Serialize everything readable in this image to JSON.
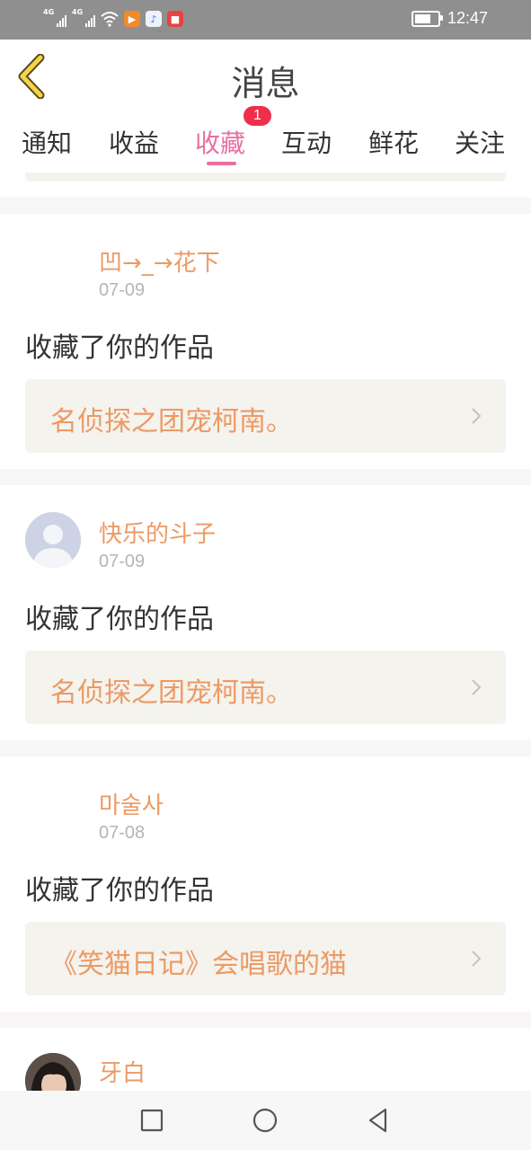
{
  "status_bar": {
    "network_1": "4G",
    "network_2": "4G",
    "time": "12:47",
    "battery_level": 0.85,
    "app_icons": [
      "video-app-icon",
      "music-app-icon",
      "shop-app-icon"
    ]
  },
  "header": {
    "title": "消息",
    "back_icon": "chevron-left-icon"
  },
  "tabs": [
    {
      "label": "通知"
    },
    {
      "label": "收益"
    },
    {
      "label": "收藏",
      "active": true,
      "badge": "1"
    },
    {
      "label": "互动"
    },
    {
      "label": "鲜花"
    },
    {
      "label": "关注"
    }
  ],
  "items": [
    {
      "user": "凹→_→花下",
      "date": "07-09",
      "action": "收藏了你的作品",
      "work": "名侦探之团宠柯南。",
      "avatar": "none"
    },
    {
      "user": "快乐的斗子",
      "date": "07-09",
      "action": "收藏了你的作品",
      "work": "名侦探之团宠柯南。",
      "avatar": "default-person-icon"
    },
    {
      "user": "마술사",
      "date": "07-08",
      "action": "收藏了你的作品",
      "work": "《笑猫日记》会唱歌的猫",
      "avatar": "none"
    },
    {
      "user": "牙白",
      "avatar": "photo"
    }
  ],
  "colors": {
    "accent": "#e86fa1",
    "name": "#ec9a66",
    "badge": "#ef2f4a",
    "back_arrow": "#f5d44a"
  },
  "nav_bar": {
    "icons": [
      "square-icon",
      "circle-icon",
      "triangle-back-icon"
    ]
  }
}
